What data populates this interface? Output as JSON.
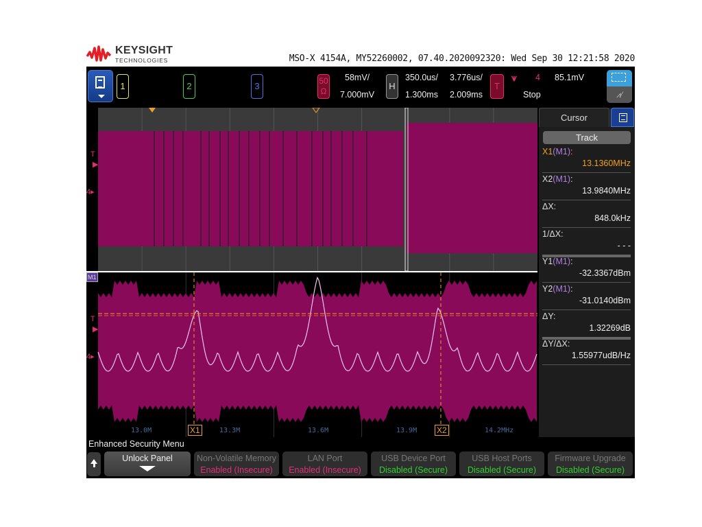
{
  "brand": {
    "name": "KEYSIGHT",
    "sub": "TECHNOLOGIES"
  },
  "header": {
    "title": "MSO-X 4154A, MY52260002, 07.40.2020092320: Wed Sep 30 12:21:58 2020"
  },
  "toolbar": {
    "channels": [
      {
        "label": "1",
        "color": "#e6e65a"
      },
      {
        "label": "2",
        "color": "#4cd04c"
      },
      {
        "label": "3",
        "color": "#5a6ee6"
      }
    ],
    "ch4": {
      "impedance_top": "50",
      "impedance_bottom": "Ω",
      "scale": "58mV/",
      "offset": "7.000mV"
    },
    "horizontal": {
      "label": "H",
      "timebase": "350.0us/",
      "delay": "1.300ms",
      "zoom_timebase": "3.776us/",
      "zoom_position": "2.009ms"
    },
    "trigger": {
      "label": "T",
      "edge": "⊔⊓",
      "source": "4",
      "level": "85.1mV",
      "status": "Stop"
    },
    "zoom_icon": "zoom-select-icon",
    "measure_icon": "measure-icon"
  },
  "waveform": {
    "side_labels": {
      "trigger": "T",
      "channel": "4",
      "math": "M1"
    },
    "freq_axis": [
      "13.0M",
      "13.3M",
      "13.6M",
      "13.9M",
      "14.2MHz"
    ],
    "cursors": {
      "x1": "X1",
      "x2": "X2"
    }
  },
  "cursor_panel": {
    "tab": "Cursor",
    "track_label": "Track",
    "rows": [
      {
        "label": "X1",
        "source": "(M1)",
        "suffix": ":",
        "value": "13.1360MHz",
        "highlight": true
      },
      {
        "label": "X2",
        "source": "(M1)",
        "suffix": ":",
        "value": "13.9840MHz"
      },
      {
        "label": "ΔX:",
        "value": "848.0kHz"
      },
      {
        "label": "1/ΔX:",
        "value": "- - -"
      },
      {
        "label": "Y1",
        "source": "(M1)",
        "suffix": ":",
        "value": "-32.3367dBm"
      },
      {
        "label": "Y2",
        "source": "(M1)",
        "suffix": ":",
        "value": "-31.0140dBm"
      },
      {
        "label": "ΔY:",
        "value": "1.32269dB"
      },
      {
        "label": "ΔY/ΔX:",
        "value": "1.55977udB/Hz"
      }
    ]
  },
  "security_menu": {
    "title": "Enhanced Security Menu",
    "unlock_label": "Unlock Panel",
    "items": [
      {
        "label": "Non-Volatile Memory",
        "status": "Enabled (Insecure)",
        "color": "#e0307a"
      },
      {
        "label": "LAN Port",
        "status": "Enabled (Insecure)",
        "color": "#e0307a"
      },
      {
        "label": "USB Device Port",
        "status": "Disabled (Secure)",
        "color": "#30d030"
      },
      {
        "label": "USB Host Ports",
        "status": "Disabled (Secure)",
        "color": "#30d030"
      },
      {
        "label": "Firmware Upgrade",
        "status": "Disabled (Secure)",
        "color": "#30d030"
      }
    ]
  }
}
